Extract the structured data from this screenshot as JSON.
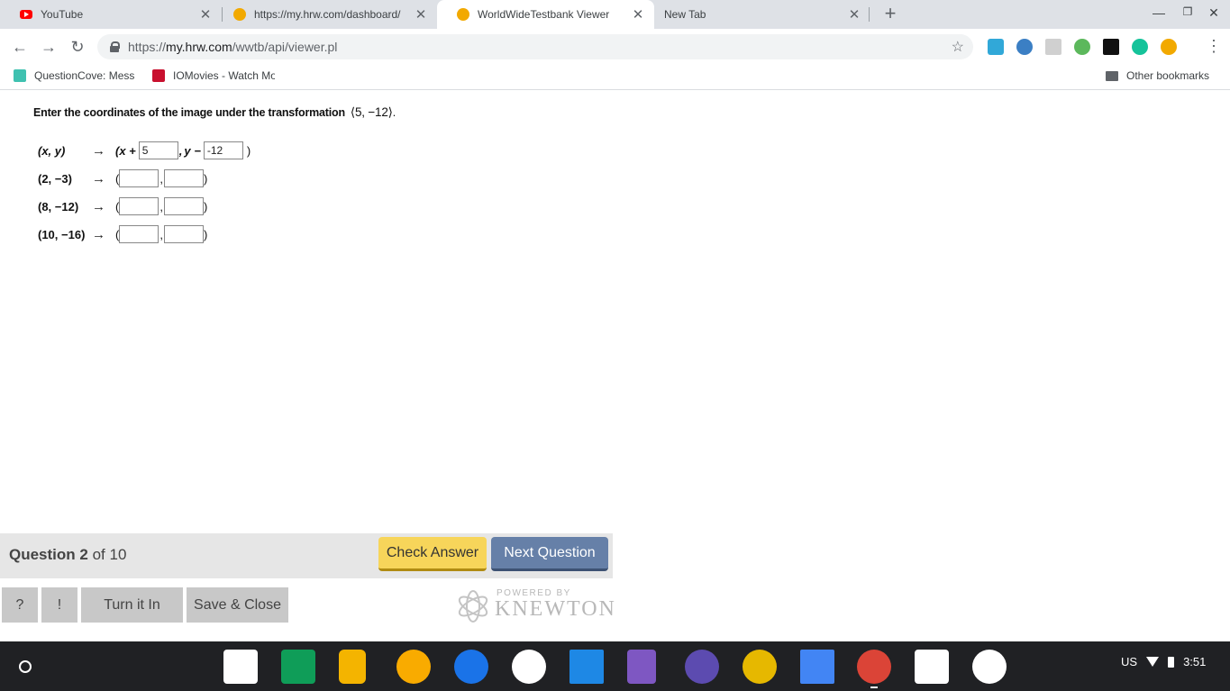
{
  "tabs": [
    {
      "title": "YouTube",
      "favicon": "youtube-icon"
    },
    {
      "title": "https://my.hrw.com/dashboard/",
      "favicon": "hrw-icon"
    },
    {
      "title": "WorldWideTestbank Viewer",
      "favicon": "hrw-icon",
      "active": true
    },
    {
      "title": "New Tab",
      "favicon": ""
    }
  ],
  "omnibox": {
    "url_prefix": "https://",
    "url_host": "my.hrw.com",
    "url_path": "/wwtb/api/viewer.pl"
  },
  "bookmarks": [
    {
      "title": "QuestionCove: Mess",
      "icon": "questioncove-icon"
    },
    {
      "title": "IOMovies - Watch Mo",
      "icon": "iomovies-icon"
    }
  ],
  "other_bookmarks": "Other bookmarks",
  "question": {
    "prompt": "Enter the coordinates of the image under the transformation",
    "vector": "⟨5, −12⟩",
    "period": ".",
    "rule": {
      "lhs": "(x, y)",
      "arrow": "→",
      "x_expr": "(x +",
      "x_value": "5",
      "y_expr": "y −",
      "y_value": "-12",
      "close": ")"
    },
    "points": [
      {
        "label": "(2, −3)",
        "x_answer": "",
        "y_answer": ""
      },
      {
        "label": "(8, −12)",
        "x_answer": "",
        "y_answer": ""
      },
      {
        "label": "(10, −16)",
        "x_answer": "",
        "y_answer": ""
      }
    ]
  },
  "footer": {
    "question_word": "Question 2",
    "of_total": "of 10",
    "check_answer": "Check Answer",
    "next_question": "Next Question",
    "help": "?",
    "hint": "!",
    "turn_in": "Turn it In",
    "save_close": "Save & Close",
    "powered_by": "POWERED BY",
    "brand": "KNEWTON"
  },
  "tray": {
    "locale": "US",
    "time": "3:51"
  },
  "colors": {
    "check_button": "#f7d55a",
    "next_button": "#6680a8",
    "shelf": "#202124"
  }
}
